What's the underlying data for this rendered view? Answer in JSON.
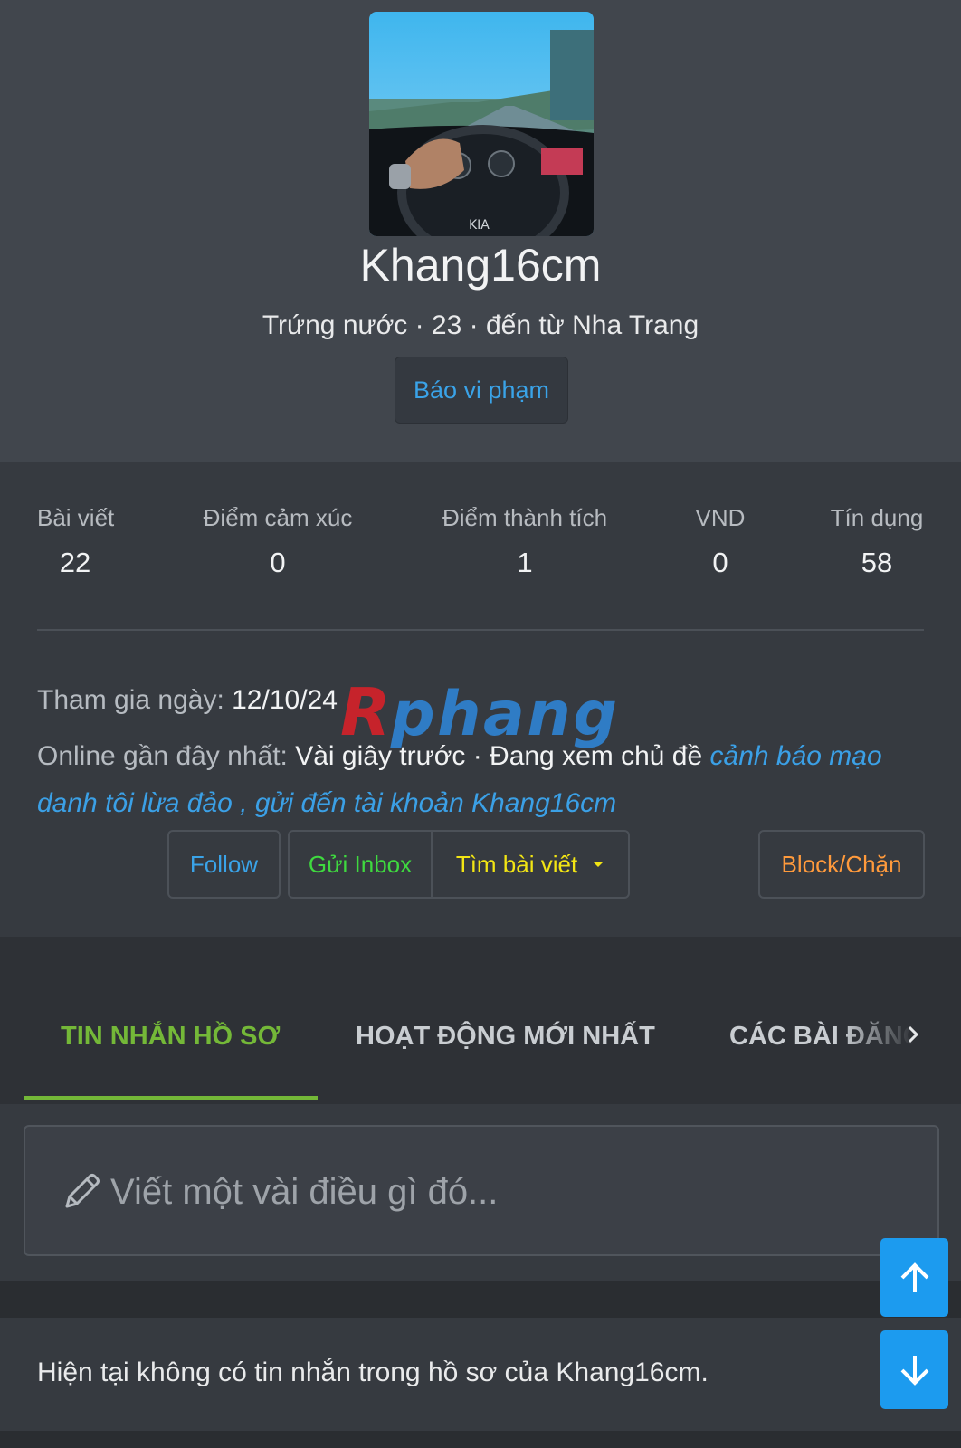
{
  "profile": {
    "username": "Khang16cm",
    "meta": "Trứng nước · 23 · đến từ Nha Trang",
    "report_label": "Báo vi phạm"
  },
  "stats": [
    {
      "label": "Bài viết",
      "value": "22"
    },
    {
      "label": "Điểm cảm xúc",
      "value": "0"
    },
    {
      "label": "Điểm thành tích",
      "value": "1"
    },
    {
      "label": "VND",
      "value": "0"
    },
    {
      "label": "Tín dụng",
      "value": "58"
    }
  ],
  "joined": {
    "label": "Tham gia ngày:",
    "value": "12/10/24"
  },
  "online": {
    "label": "Online gần đây nhất:",
    "value": "Vài giây trước · Đang xem chủ đề",
    "link_line1": "cảnh báo mạo",
    "link_line2": "danh tôi lừa đảo , gửi đến tài khoản Khang16cm"
  },
  "watermark": "Rphang",
  "actions": {
    "follow": "Follow",
    "inbox": "Gửi Inbox",
    "find_posts": "Tìm bài viết",
    "block": "Block/Chặn"
  },
  "tabs": [
    {
      "label": "TIN NHẮN HỒ SƠ",
      "active": true
    },
    {
      "label": "HOẠT ĐỘNG MỚI NHẤT",
      "active": false
    },
    {
      "label": "CÁC BÀI ĐĂNG",
      "active": false
    }
  ],
  "composer": {
    "placeholder": "Viết một vài điều gì đó..."
  },
  "empty_message": "Hiện tại không có tin nhắn trong hồ sơ của Khang16cm.",
  "colors": {
    "link": "#3ba0e6",
    "follow": "#3aa3e8",
    "inbox": "#3fd93f",
    "find": "#f2e514",
    "block": "#ff9a3c",
    "tab_active": "#74b838",
    "scroll_button": "#1c9bef"
  },
  "icons": {
    "pencil": "pencil-icon",
    "dropdown": "caret-down-icon",
    "tabs_scroll": "chevron-right-icon",
    "scroll_up": "arrow-up-icon",
    "scroll_down": "arrow-down-icon"
  }
}
